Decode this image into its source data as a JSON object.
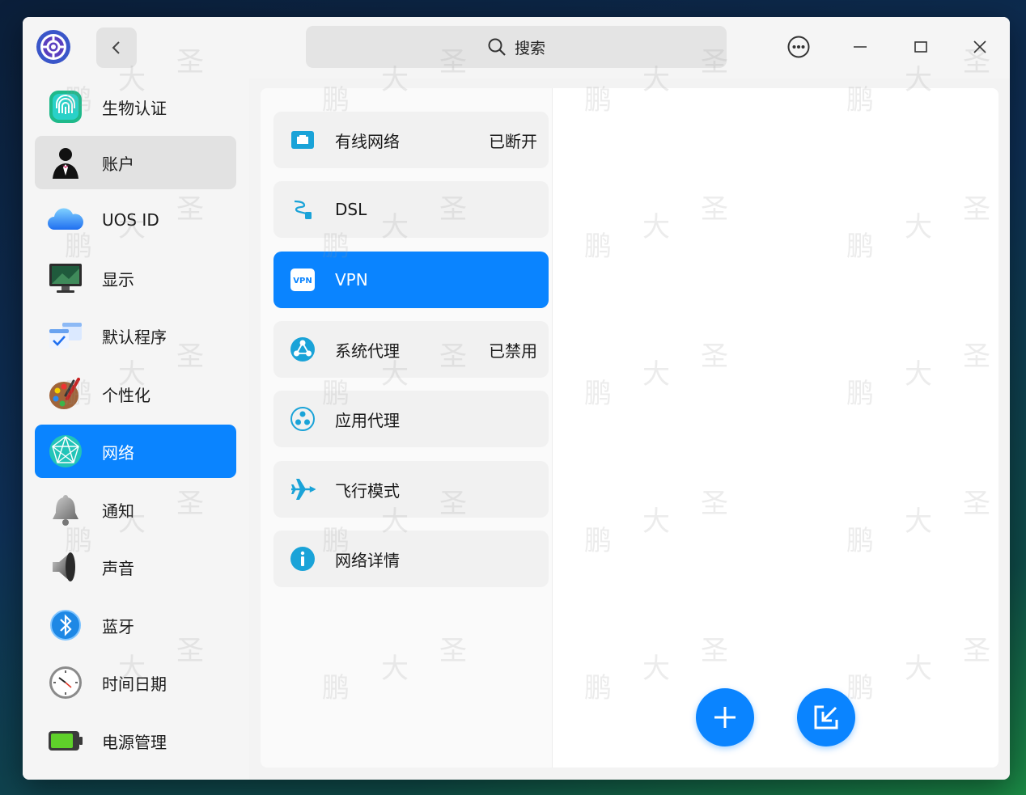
{
  "titlebar": {
    "search_label": "搜索"
  },
  "sidebar": {
    "items": [
      {
        "label": "生物认证",
        "icon": "fingerprint-icon"
      },
      {
        "label": "账户",
        "icon": "account-icon"
      },
      {
        "label": "UOS ID",
        "icon": "cloud-icon"
      },
      {
        "label": "显示",
        "icon": "display-icon"
      },
      {
        "label": "默认程序",
        "icon": "default-apps-icon"
      },
      {
        "label": "个性化",
        "icon": "palette-icon"
      },
      {
        "label": "网络",
        "icon": "network-icon"
      },
      {
        "label": "通知",
        "icon": "bell-icon"
      },
      {
        "label": "声音",
        "icon": "speaker-icon"
      },
      {
        "label": "蓝牙",
        "icon": "bluetooth-icon"
      },
      {
        "label": "时间日期",
        "icon": "clock-icon"
      },
      {
        "label": "电源管理",
        "icon": "battery-icon"
      }
    ]
  },
  "network_list": {
    "items": [
      {
        "label": "有线网络",
        "status": "已断开",
        "icon": "ethernet-icon"
      },
      {
        "label": "DSL",
        "status": "",
        "icon": "dsl-icon"
      },
      {
        "label": "VPN",
        "status": "",
        "icon": "vpn-icon"
      },
      {
        "label": "系统代理",
        "status": "已禁用",
        "icon": "system-proxy-icon"
      },
      {
        "label": "应用代理",
        "status": "",
        "icon": "app-proxy-icon"
      },
      {
        "label": "飞行模式",
        "status": "",
        "icon": "airplane-icon"
      },
      {
        "label": "网络详情",
        "status": "",
        "icon": "info-icon"
      }
    ]
  },
  "watermark": {
    "char1": "大",
    "char2": "圣",
    "char3": "鹏"
  },
  "colors": {
    "accent": "#0a84ff",
    "sidebar_hover": "#e2e2e2"
  }
}
